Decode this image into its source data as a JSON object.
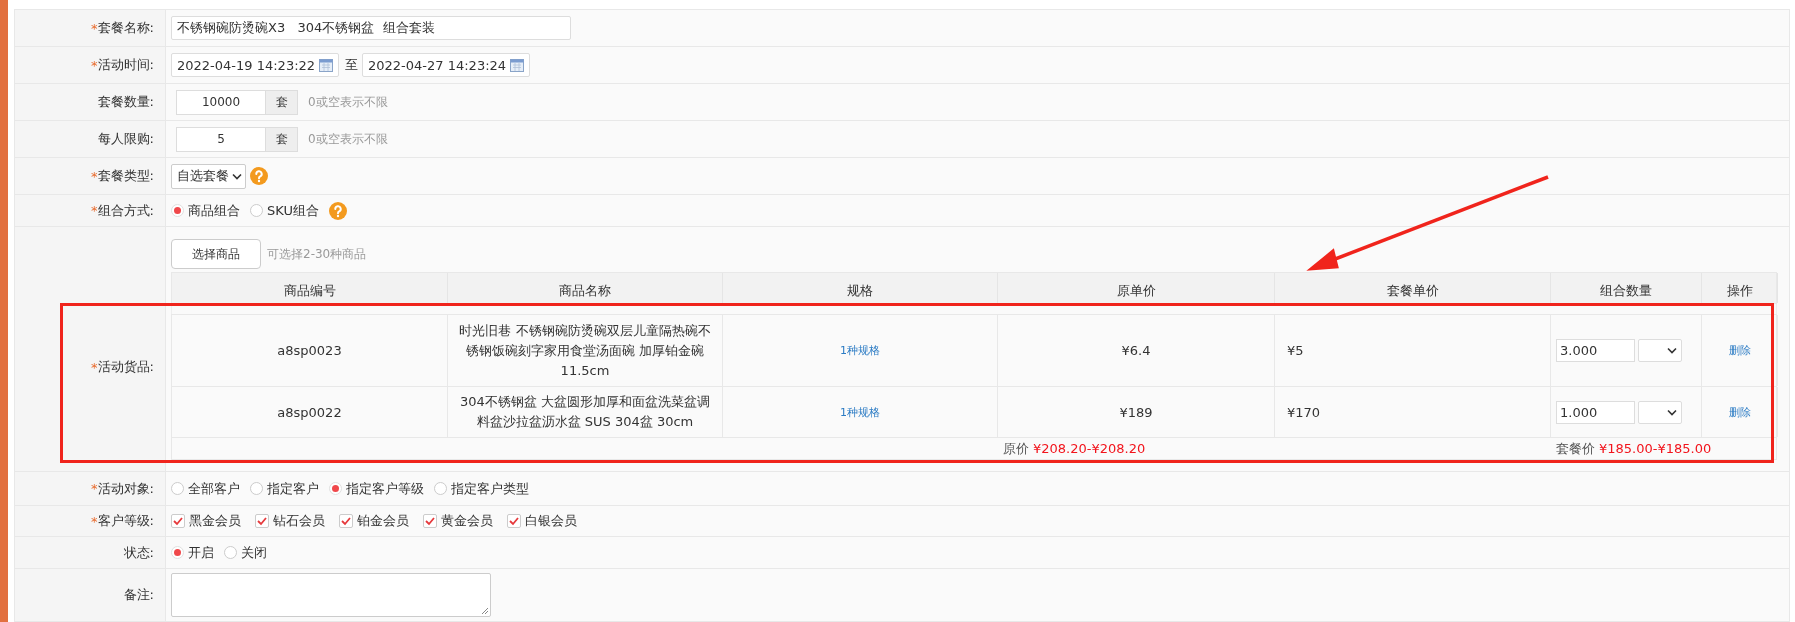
{
  "form": {
    "name": {
      "mark": "*",
      "label": "套餐名称:",
      "value": "不锈钢碗防烫碗X3   304不锈钢盆  组合套装"
    },
    "time": {
      "mark": "*",
      "label": "活动时间:",
      "start": "2022-04-19 14:23:22",
      "separator": "至",
      "end": "2022-04-27 14:23:24"
    },
    "quantity": {
      "label": "套餐数量:",
      "value": "10000",
      "unit": "套",
      "hint": "0或空表示不限"
    },
    "limit": {
      "label": "每人限购:",
      "value": "5",
      "unit": "套",
      "hint": "0或空表示不限"
    },
    "package_type": {
      "mark": "*",
      "label": "套餐类型:",
      "value": "自选套餐"
    },
    "combine_mode": {
      "mark": "*",
      "label": "组合方式:",
      "options": [
        {
          "label": "商品组合",
          "selected": true
        },
        {
          "label": "SKU组合",
          "selected": false
        }
      ]
    },
    "goods": {
      "mark": "*",
      "label": "活动货品:",
      "select_button": "选择商品",
      "hint": "可选择2-30种商品",
      "columns": [
        "商品编号",
        "商品名称",
        "规格",
        "原单价",
        "套餐单价",
        "组合数量",
        "操作"
      ],
      "rows": [
        {
          "code": "a8sp0023",
          "name": "时光旧巷 不锈钢碗防烫碗双层儿童隔热碗不锈钢饭碗刻字家用食堂汤面碗 加厚铂金碗 11.5cm",
          "spec": "1种规格",
          "price": "¥6.4",
          "package_price": "¥5",
          "quantity": "3.000",
          "action": "删除"
        },
        {
          "code": "a8sp0022",
          "name": "304不锈钢盆 大盆圆形加厚和面盆洗菜盆调料盆沙拉盆沥水盆 SUS 304盆 30cm",
          "spec": "1种规格",
          "price": "¥189",
          "package_price": "¥170",
          "quantity": "1.000",
          "action": "删除"
        }
      ],
      "footer": {
        "original_label": "原价",
        "original_value": "¥208.20-¥208.20",
        "package_label": "套餐价",
        "package_value": "¥185.00-¥185.00"
      }
    },
    "target": {
      "mark": "*",
      "label": "活动对象:",
      "options": [
        {
          "label": "全部客户",
          "selected": false
        },
        {
          "label": "指定客户",
          "selected": false
        },
        {
          "label": "指定客户等级",
          "selected": true
        },
        {
          "label": "指定客户类型",
          "selected": false
        }
      ]
    },
    "customer_level": {
      "mark": "*",
      "label": "客户等级:",
      "options": [
        {
          "label": "黑金会员",
          "checked": true
        },
        {
          "label": "钻石会员",
          "checked": true
        },
        {
          "label": "铂金会员",
          "checked": true
        },
        {
          "label": "黄金会员",
          "checked": true
        },
        {
          "label": "白银会员",
          "checked": true
        }
      ]
    },
    "status": {
      "label": "状态:",
      "options": [
        {
          "label": "开启",
          "selected": true
        },
        {
          "label": "关闭",
          "selected": false
        }
      ]
    },
    "remark": {
      "label": "备注:"
    }
  }
}
